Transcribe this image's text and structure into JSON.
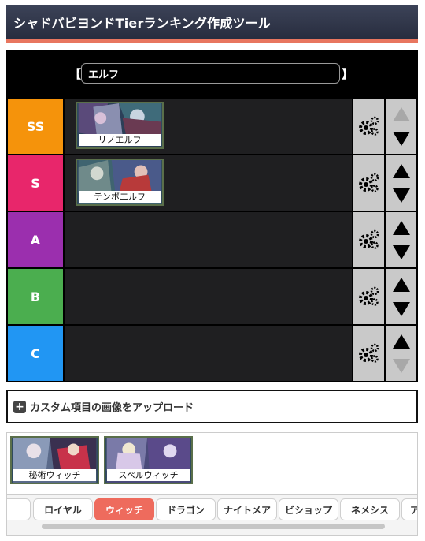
{
  "header": {
    "title": "シャドバビヨンドTierランキング作成ツール"
  },
  "colors": {
    "accent": "#e8765f",
    "tab_active": "#ee6b5d"
  },
  "list_name": {
    "open_bracket": "【",
    "value": "エルフ",
    "close_bracket": "】"
  },
  "tiers": [
    {
      "label": "SS",
      "color": "#f5930b"
    },
    {
      "label": "S",
      "color": "#e8266b"
    },
    {
      "label": "A",
      "color": "#9b2fae"
    },
    {
      "label": "B",
      "color": "#4bae4f"
    },
    {
      "label": "C",
      "color": "#2196f3"
    }
  ],
  "placed_cards": {
    "ss": [
      {
        "name": "リノエルフ"
      }
    ],
    "s": [
      {
        "name": "テンポエルフ"
      }
    ]
  },
  "upload": {
    "label": "カスタム項目の画像をアップロード"
  },
  "pool": {
    "cards": [
      {
        "name": "秘術ウィッチ"
      },
      {
        "name": "スペルウィッチ"
      }
    ]
  },
  "tabs": {
    "items": [
      "フ",
      "ロイヤル",
      "ウィッチ",
      "ドラゴン",
      "ナイトメア",
      "ビショップ",
      "ネメシス",
      "ア"
    ],
    "active": "ウィッチ"
  },
  "icons": {
    "settings": "gears-icon",
    "up": "arrow-up-icon",
    "down": "arrow-down-icon",
    "add": "plus-square-icon"
  }
}
